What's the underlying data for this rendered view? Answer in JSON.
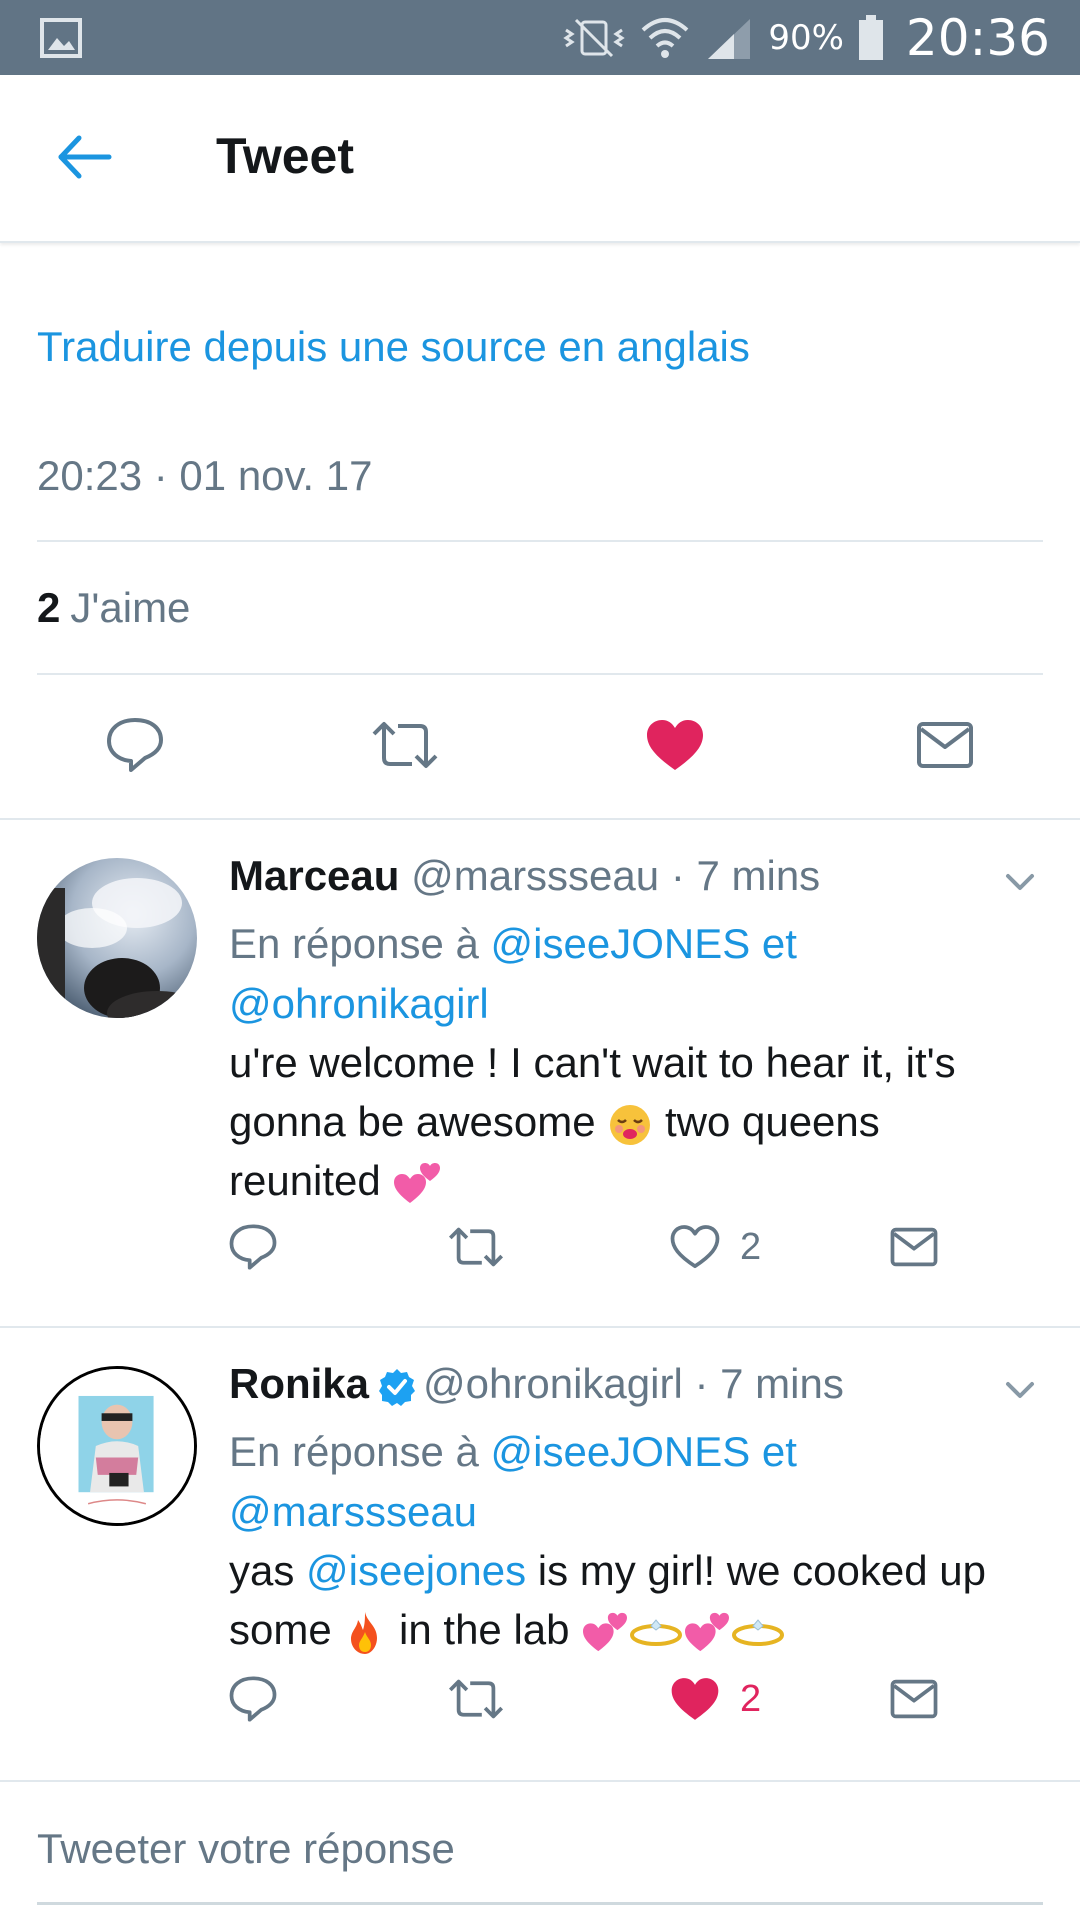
{
  "status_bar": {
    "battery": "90%",
    "time": "20:36",
    "icons": [
      "gallery-icon",
      "vibrate-mute-icon",
      "wifi-icon",
      "signal-icon",
      "battery-icon"
    ]
  },
  "header": {
    "title": "Tweet",
    "back_icon": "arrow-left-icon"
  },
  "tweet": {
    "translate": "Traduire depuis une source en anglais",
    "timestamp": "20:23 · 01 nov. 17",
    "likes_count": "2",
    "likes_label": "J'aime",
    "liked": true,
    "actions": [
      "reply-icon",
      "retweet-icon",
      "like-icon",
      "message-icon"
    ]
  },
  "replies": [
    {
      "name": "Marceau",
      "handle": "@marssseau",
      "time": "· 7 mins",
      "verified": false,
      "reply_prefix": "En réponse à",
      "mention1": "@iseeJONES",
      "conj": "et",
      "mention2": "@ohronikagirl",
      "text_line1": "u're welcome ! I can't wait to hear it, it's",
      "text_line2a": "gonna be awesome",
      "text_line2b": "two queens",
      "text_line3": "reunited",
      "like_count": "2",
      "liked": false
    },
    {
      "name": "Ronika",
      "handle": "@ohronikagirl",
      "time": "· 7 mins",
      "verified": true,
      "reply_prefix": "En réponse à",
      "mention1": "@iseeJONES",
      "conj": "et",
      "mention2": "@marssseau",
      "text_a": "yas",
      "text_mention": "@iseejones",
      "text_b": "is my girl! we cooked up",
      "text_c": "some",
      "text_d": "in the lab",
      "like_count": "2",
      "liked": true
    }
  ],
  "compose": {
    "placeholder": "Tweeter votre réponse"
  },
  "colors": {
    "accent": "#1b95e0",
    "like": "#e0245e",
    "muted": "#657786",
    "status_bar": "#617485"
  }
}
